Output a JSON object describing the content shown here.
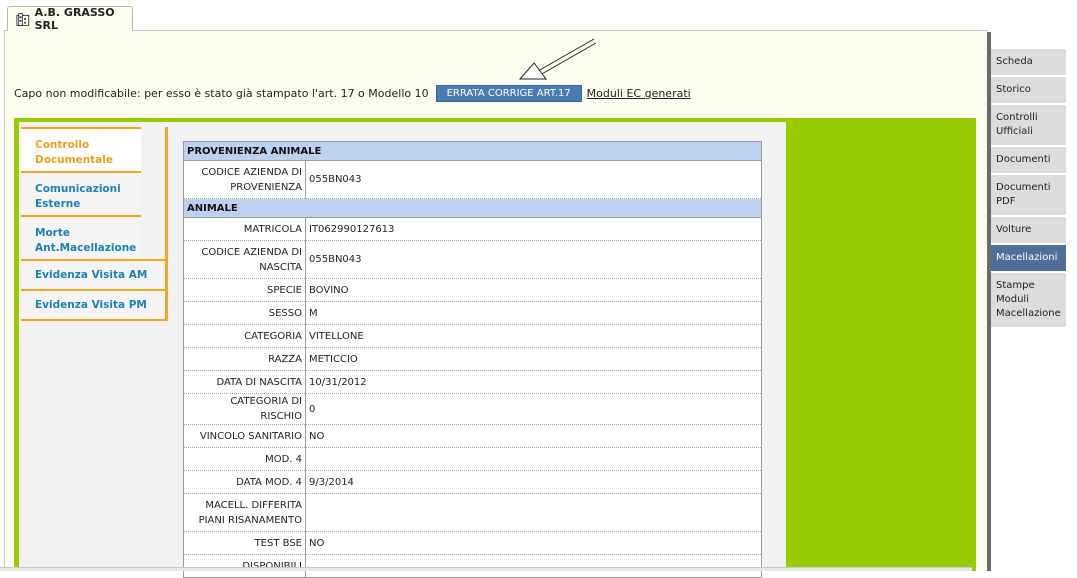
{
  "tab": {
    "title": "A.B. GRASSO SRL",
    "icon": "building-icon"
  },
  "notice": {
    "text": "Capo non modificabile: per esso è stato già stampato l'art. 17 o Modello 10",
    "errata_button": "ERRATA CORRIGE ART.17",
    "moduli_link": "Moduli EC generati"
  },
  "left_nav": [
    {
      "label": "Controllo Documentale",
      "active": true
    },
    {
      "label": "Comunicazioni Esterne"
    },
    {
      "label": "Morte Ant.Macellazione"
    },
    {
      "label": "Evidenza Visita AM"
    },
    {
      "label": "Evidenza Visita PM"
    }
  ],
  "sections": {
    "provenienza": {
      "title": "PROVENIENZA ANIMALE",
      "rows": [
        {
          "label": "CODICE AZIENDA DI PROVENIENZA",
          "value": "055BN043"
        }
      ]
    },
    "animale": {
      "title": "ANIMALE",
      "rows": [
        {
          "label": "MATRICOLA",
          "value": "IT062990127613"
        },
        {
          "label": "CODICE AZIENDA DI NASCITA",
          "value": "055BN043"
        },
        {
          "label": "SPECIE",
          "value": "BOVINO"
        },
        {
          "label": "SESSO",
          "value": "M"
        },
        {
          "label": "CATEGORIA",
          "value": "VITELLONE"
        },
        {
          "label": "RAZZA",
          "value": "METICCIO"
        },
        {
          "label": "DATA DI NASCITA",
          "value": "10/31/2012"
        },
        {
          "label": "CATEGORIA DI RISCHIO",
          "value": "0"
        },
        {
          "label": "VINCOLO SANITARIO",
          "value": "NO"
        },
        {
          "label": "MOD. 4",
          "value": ""
        },
        {
          "label": "DATA MOD. 4",
          "value": "9/3/2014"
        },
        {
          "label": "MACELL. DIFFERITA PIANI RISANAMENTO",
          "value": ""
        },
        {
          "label": "TEST BSE",
          "value": "NO"
        },
        {
          "label": "DISPONIBILI",
          "value": ""
        }
      ]
    }
  },
  "right_nav": [
    {
      "label": "Scheda"
    },
    {
      "label": "Storico"
    },
    {
      "label": "Controlli Ufficiali"
    },
    {
      "label": "Documenti"
    },
    {
      "label": "Documenti PDF"
    },
    {
      "label": "Volture"
    },
    {
      "label": "Macellazioni",
      "active": true
    },
    {
      "label": "Stampe Moduli Macellazione"
    }
  ],
  "colors": {
    "accent_green": "#99cc00",
    "nav_orange": "#f5a623",
    "header_blue": "#bdd0f2",
    "button_blue": "#4c7bb3",
    "active_right": "#4d6f9a"
  }
}
